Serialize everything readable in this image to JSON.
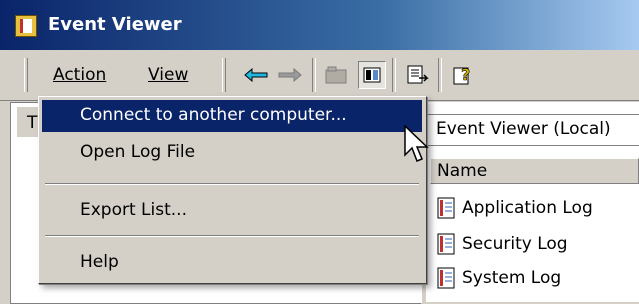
{
  "window": {
    "title": "Event Viewer"
  },
  "menubar": {
    "action": "Action",
    "view": "View"
  },
  "toolbar": {
    "buttons": [
      "back-arrow-icon",
      "forward-arrow-icon",
      "folder-icon",
      "show-hide-tree-icon",
      "export-icon",
      "help-icon"
    ]
  },
  "left_pane": {
    "tab_label": "T"
  },
  "right_pane": {
    "header": "Event Viewer (Local)",
    "column_name": "Name",
    "logs": [
      "Application Log",
      "Security Log",
      "System Log"
    ]
  },
  "dropdown": {
    "items": [
      {
        "label": "Connect to another computer...",
        "active": true
      },
      {
        "label": "Open Log File",
        "active": false
      },
      {
        "label": "Export List...",
        "active": false
      },
      {
        "label": "Help",
        "active": false
      }
    ]
  },
  "colors": {
    "highlight": "#0a246a",
    "face": "#d4d0c8",
    "title_start": "#0a246a",
    "title_end": "#a6caf0"
  }
}
